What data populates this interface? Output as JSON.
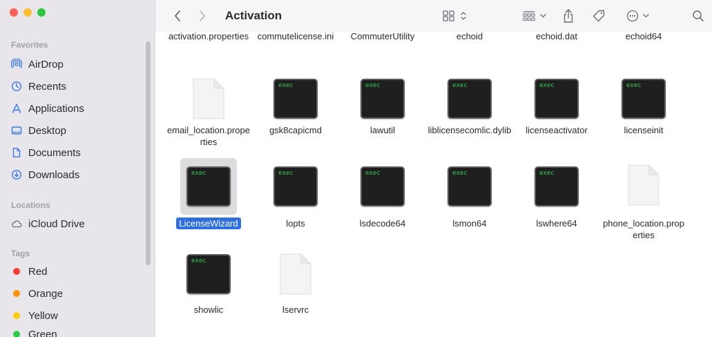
{
  "window": {
    "title": "Activation",
    "traffic_colors": [
      "#fe5f57",
      "#febc2e",
      "#28c840"
    ]
  },
  "sidebar": {
    "favorites_title": "Favorites",
    "favorites": [
      {
        "label": "AirDrop",
        "icon": "airdrop-icon"
      },
      {
        "label": "Recents",
        "icon": "clock-icon"
      },
      {
        "label": "Applications",
        "icon": "applications-icon"
      },
      {
        "label": "Desktop",
        "icon": "desktop-icon"
      },
      {
        "label": "Documents",
        "icon": "document-icon"
      },
      {
        "label": "Downloads",
        "icon": "download-icon"
      }
    ],
    "locations_title": "Locations",
    "locations": [
      {
        "label": "iCloud Drive",
        "icon": "cloud-icon"
      }
    ],
    "tags_title": "Tags",
    "tags": [
      {
        "label": "Red",
        "color": "#fe3b30"
      },
      {
        "label": "Orange",
        "color": "#fe9500"
      },
      {
        "label": "Yellow",
        "color": "#fecc00"
      },
      {
        "label": "Green",
        "color": "#28cd41"
      }
    ]
  },
  "toolbar": {
    "back_icon": "chevron-left-icon",
    "forward_icon": "chevron-right-icon",
    "view_icon": "grid-view-icon",
    "group_icon": "group-icon",
    "share_icon": "share-icon",
    "tag_icon": "tag-icon",
    "more_icon": "ellipsis-circle-icon",
    "search_icon": "search-icon"
  },
  "files": {
    "row0": [
      "activation.properties",
      "commutelicense.ini",
      "CommuterUtility",
      "echoid",
      "echoid.dat",
      "echoid64"
    ],
    "row1": [
      {
        "name": "email_location.properties",
        "type": "doc"
      },
      {
        "name": "gsk8capicmd",
        "type": "exec"
      },
      {
        "name": "lawutil",
        "type": "exec"
      },
      {
        "name": "liblicensecomlic.dylib",
        "type": "exec"
      },
      {
        "name": "licenseactivator",
        "type": "exec"
      },
      {
        "name": "licenseinit",
        "type": "exec"
      }
    ],
    "row2": [
      {
        "name": "LicenseWizard",
        "type": "exec",
        "selected": true
      },
      {
        "name": "lopts",
        "type": "exec"
      },
      {
        "name": "lsdecode64",
        "type": "exec"
      },
      {
        "name": "lsmon64",
        "type": "exec"
      },
      {
        "name": "lswhere64",
        "type": "exec"
      },
      {
        "name": "phone_location.properties",
        "type": "doc"
      }
    ],
    "row3": [
      {
        "name": "showlic",
        "type": "exec"
      },
      {
        "name": "lservrc",
        "type": "doc"
      }
    ],
    "exec_label": "exec"
  }
}
